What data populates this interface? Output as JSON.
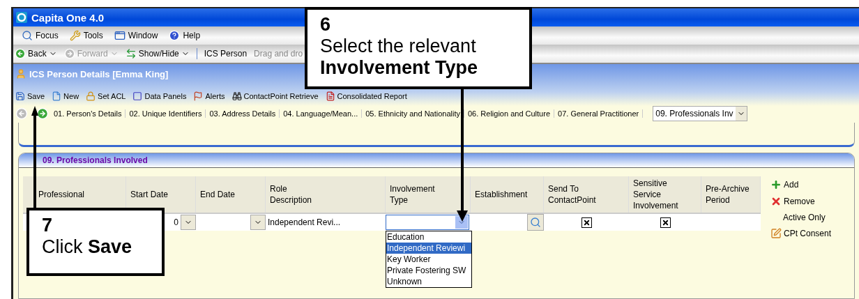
{
  "window": {
    "title": "Capita One 4.0"
  },
  "menu": [
    {
      "label": "Focus"
    },
    {
      "label": "Tools"
    },
    {
      "label": "Window"
    },
    {
      "label": "Help"
    }
  ],
  "nav": {
    "items": [
      {
        "label": "Back",
        "disabled": false
      },
      {
        "label": "Forward",
        "disabled": true
      },
      {
        "label": "Show/Hide",
        "disabled": false
      }
    ],
    "context": "ICS Person",
    "hint": "Drag and dro"
  },
  "person_window": {
    "title": "ICS Person Details [Emma King]",
    "toolbar": [
      "Save",
      "New",
      "Set ACL",
      "Data Panels",
      "Alerts",
      "ContactPoint Retrieve",
      "Consolidated Report"
    ],
    "tabs": [
      "01. Person's Details",
      "02. Unique Identifiers",
      "03. Address Details",
      "04. Language/Mean...",
      "05. Ethnicity and Nationality",
      "06. Religion and Culture",
      "07. General Practitioner"
    ],
    "panel_select": "09. Professionals Inv"
  },
  "section": {
    "title": "09. Professionals Involved",
    "columns": [
      "Professional",
      "Start Date",
      "End Date",
      "Role\nDescription",
      "Involvement\nType",
      "Establishment",
      "Send To\nContactPoint",
      "Sensitive\nService\nInvolvement",
      "Pre-Archive\nPeriod"
    ],
    "rows": [
      {
        "start_date": "0",
        "end_date": "",
        "role": "Independent Revi...",
        "involvement_expanded": true,
        "send_to_contactpoint": true,
        "sensitive": true
      }
    ],
    "options": [
      {
        "label": "Education",
        "selected": false
      },
      {
        "label": "Independent Reviewi",
        "selected": true
      },
      {
        "label": "Key Worker",
        "selected": false
      },
      {
        "label": "Private Fostering SW",
        "selected": false
      },
      {
        "label": "Unknown",
        "selected": false
      }
    ],
    "actions": [
      "Add",
      "Remove",
      "Active Only",
      "CPt Consent"
    ]
  },
  "callouts": [
    {
      "step": "6",
      "text": "Select the relevant **Involvement Type**"
    },
    {
      "step": "7",
      "text": "Click **Save**"
    }
  ]
}
